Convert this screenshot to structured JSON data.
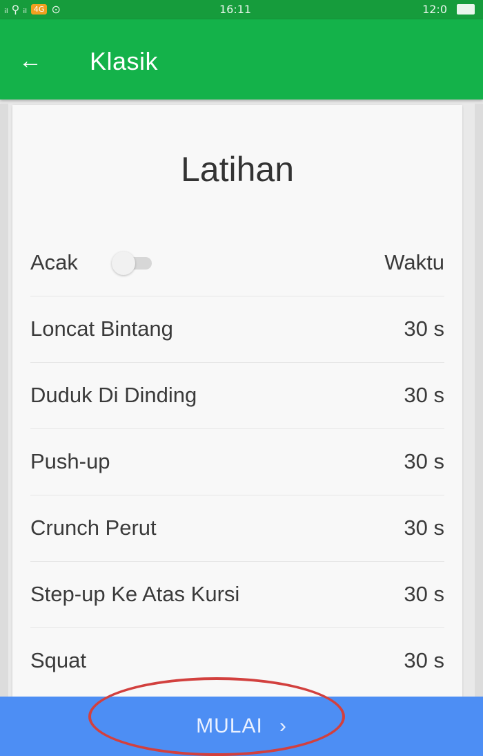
{
  "status_bar": {
    "left_text": "ᵢₗ ⚲ ᵢₗ",
    "badge": "4G",
    "extra": "⊙",
    "time": "16:11",
    "right_text": "12:0"
  },
  "app_bar": {
    "back_icon": "arrow-left-icon",
    "title": "Klasik"
  },
  "card": {
    "title": "Latihan",
    "header_row": {
      "random_label": "Acak",
      "random_enabled": false,
      "time_header": "Waktu"
    },
    "exercises": [
      {
        "name": "Loncat Bintang",
        "duration": "30 s"
      },
      {
        "name": "Duduk Di Dinding",
        "duration": "30 s"
      },
      {
        "name": "Push-up",
        "duration": "30 s"
      },
      {
        "name": "Crunch Perut",
        "duration": "30 s"
      },
      {
        "name": "Step-up Ke Atas Kursi",
        "duration": "30 s"
      },
      {
        "name": "Squat",
        "duration": "30 s"
      }
    ]
  },
  "start": {
    "label": "MULAI",
    "chevron": "›"
  },
  "colors": {
    "status_bar": "#169c3c",
    "app_bar": "#14b24a",
    "start_bar": "#4d8ef4",
    "annotation": "#d2403e"
  }
}
